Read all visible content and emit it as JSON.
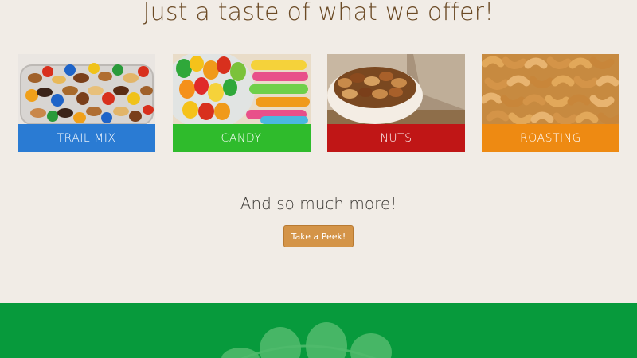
{
  "headline": "Just a taste of what we offer!",
  "categories": [
    {
      "label": "TRAIL MIX",
      "color": "#2a7bd3",
      "image": "trail-mix-photo"
    },
    {
      "label": "CANDY",
      "color": "#2fbb2c",
      "image": "gummy-candy-photo"
    },
    {
      "label": "NUTS",
      "color": "#c01616",
      "image": "mixed-nuts-photo"
    },
    {
      "label": "ROASTING",
      "color": "#ee8a12",
      "image": "cashews-photo"
    }
  ],
  "subhead": "And so much more!",
  "cta": {
    "label": "Take a Peek!"
  },
  "colors": {
    "page_background": "#f1ece6",
    "headline": "#6b4a25",
    "button": "#d49448",
    "footer": "#079a3c"
  },
  "footer": {
    "logo": "peanut-logo"
  }
}
